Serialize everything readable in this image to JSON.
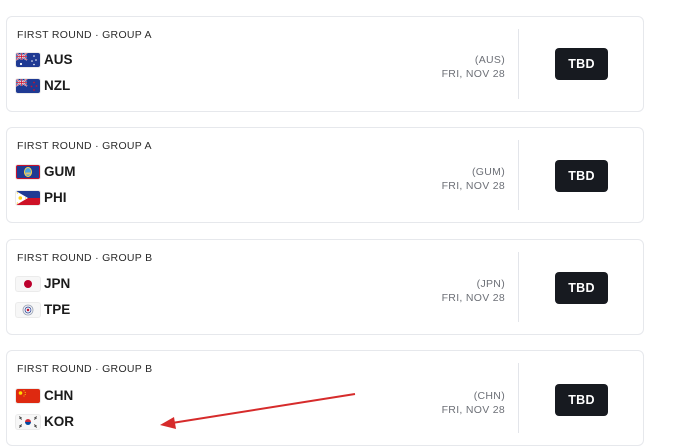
{
  "games": [
    {
      "round_label": "FIRST ROUND · GROUP A",
      "home": {
        "code": "AUS",
        "flag": "australia-flag"
      },
      "away": {
        "code": "NZL",
        "flag": "new-zealand-flag"
      },
      "venue": "(AUS)",
      "date": "FRI, NOV 28",
      "button": "TBD"
    },
    {
      "round_label": "FIRST ROUND · GROUP A",
      "home": {
        "code": "GUM",
        "flag": "guam-flag"
      },
      "away": {
        "code": "PHI",
        "flag": "philippines-flag"
      },
      "venue": "(GUM)",
      "date": "FRI, NOV 28",
      "button": "TBD"
    },
    {
      "round_label": "FIRST ROUND · GROUP B",
      "home": {
        "code": "JPN",
        "flag": "japan-flag"
      },
      "away": {
        "code": "TPE",
        "flag": "chinese-taipei-flag"
      },
      "venue": "(JPN)",
      "date": "FRI, NOV 28",
      "button": "TBD"
    },
    {
      "round_label": "FIRST ROUND · GROUP B",
      "home": {
        "code": "CHN",
        "flag": "china-flag"
      },
      "away": {
        "code": "KOR",
        "flag": "korea-flag"
      },
      "venue": "(CHN)",
      "date": "FRI, NOV 28",
      "button": "TBD"
    }
  ],
  "colors": {
    "button_bg": "#171a20",
    "arrow": "#d62b2b",
    "card_border": "#e6e8ec"
  }
}
